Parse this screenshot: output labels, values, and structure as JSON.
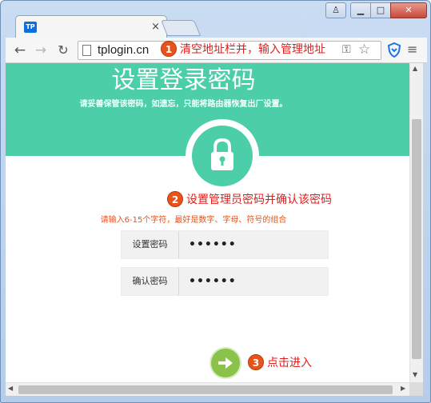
{
  "browser": {
    "tab": {
      "favicon_text": "TP",
      "close_glyph": "×"
    },
    "window_controls": {
      "user_glyph": "♙",
      "min_glyph": "▁",
      "max_glyph": "□",
      "close_glyph": "✕"
    },
    "nav": {
      "back_glyph": "←",
      "forward_glyph": "→",
      "reload_glyph": "↻"
    },
    "address_bar": {
      "url": "tplogin.cn"
    },
    "toolbar_icons": {
      "key": "key-icon",
      "star": "star-icon",
      "shield": "shield-icon",
      "menu": "menu-icon",
      "star_glyph": "☆",
      "menu_glyph": "≡",
      "key_glyph": "⚿"
    }
  },
  "annotations": [
    {
      "num": "1",
      "text": "清空地址栏并，输入管理地址"
    },
    {
      "num": "2",
      "text": "设置管理员密码并确认该密码"
    },
    {
      "num": "3",
      "text": "点击进入"
    }
  ],
  "page": {
    "title": "设置登录密码",
    "subtitle": "请妥善保管该密码，如遗忘，只能将路由器恢复出厂设置。",
    "hint": "请输入6-15个字符，最好是数字、字母、符号的组合",
    "fields": [
      {
        "label": "设置密码",
        "value": "••••••"
      },
      {
        "label": "确认密码",
        "value": "••••••"
      }
    ],
    "submit_icon": "arrow-right-icon"
  },
  "colors": {
    "accent": "#4ccfa9",
    "button": "#8bc34a",
    "annotation": "#e01f1f",
    "badge": "#e8531c"
  }
}
